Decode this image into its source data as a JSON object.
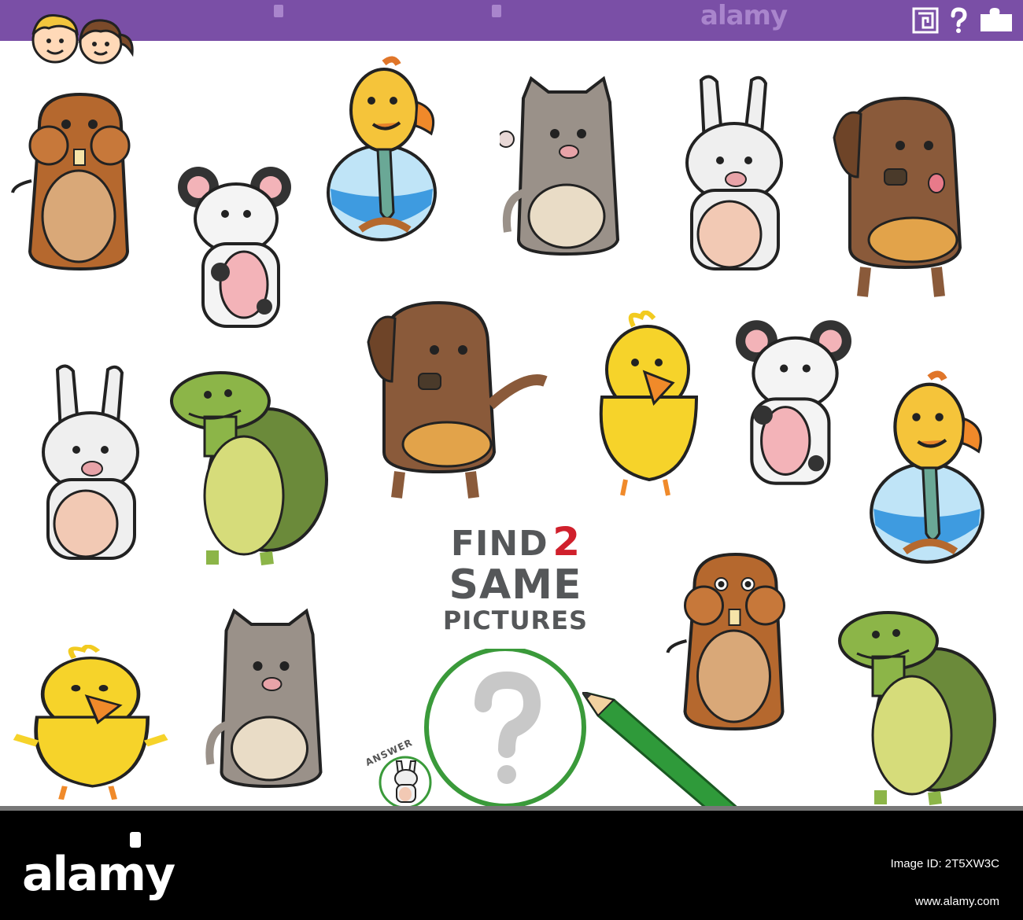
{
  "header": {
    "watermark": "alamy"
  },
  "puzzle": {
    "find": "FIND",
    "count": "2",
    "same": "SAME",
    "pictures": "PICTURES",
    "answer_label": "ANSWER"
  },
  "footer": {
    "logo": "alamy",
    "image_id_label": "Image ID: 2T5XW3C",
    "image_id": "2T5XW3C",
    "url": "www.alamy.com"
  },
  "animals": [
    {
      "kind": "hamster",
      "color": "#b5682e"
    },
    {
      "kind": "mouse",
      "color": "#f4f4f4"
    },
    {
      "kind": "goldfish-bowl",
      "color": "#f5c43a"
    },
    {
      "kind": "cat",
      "color": "#9a9189"
    },
    {
      "kind": "rabbit",
      "color": "#efefef"
    },
    {
      "kind": "dog",
      "color": "#8a5a3a"
    },
    {
      "kind": "dog",
      "color": "#8a5a3a"
    },
    {
      "kind": "canary",
      "color": "#f6d32a"
    },
    {
      "kind": "mouse",
      "color": "#f4f4f4"
    },
    {
      "kind": "rabbit",
      "color": "#efefef"
    },
    {
      "kind": "turtle",
      "color": "#8cb548"
    },
    {
      "kind": "goldfish-bowl",
      "color": "#f5c43a"
    },
    {
      "kind": "hamster",
      "color": "#b5682e"
    },
    {
      "kind": "turtle",
      "color": "#8cb548"
    },
    {
      "kind": "canary",
      "color": "#f6d32a"
    },
    {
      "kind": "cat",
      "color": "#9a9189"
    }
  ],
  "colors": {
    "header": "#7a4fa6",
    "title": "#555759",
    "accent": "#d0202c",
    "magnifier": "#3a9a3a",
    "pencil": "#2f9a3a"
  }
}
